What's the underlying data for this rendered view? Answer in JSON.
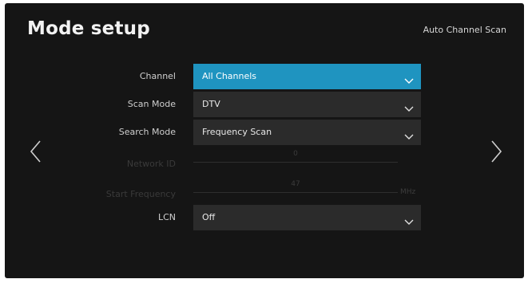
{
  "header": {
    "title": "Mode setup",
    "context_label": "Auto Channel Scan"
  },
  "navigation": {
    "prev_icon": "chevron-left-icon",
    "next_icon": "chevron-right-icon"
  },
  "settings": {
    "channel": {
      "label": "Channel",
      "value": "All Channels"
    },
    "scan_mode": {
      "label": "Scan Mode",
      "value": "DTV"
    },
    "search_mode": {
      "label": "Search Mode",
      "value": "Frequency Scan"
    },
    "network_id": {
      "label": "Network ID",
      "value": "0"
    },
    "start_frequency": {
      "label": "Start Frequency",
      "value": "47",
      "unit": "MHz"
    },
    "lcn": {
      "label": "LCN",
      "value": "Off"
    }
  },
  "colors": {
    "background": "#151515",
    "accent": "#1f94c0",
    "field": "#2b2b2b",
    "disabled_text": "#3a3a3a"
  }
}
